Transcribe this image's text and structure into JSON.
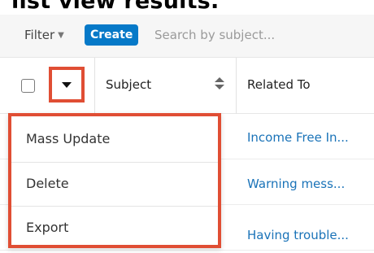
{
  "heading": {
    "text": "list view results."
  },
  "toolbar": {
    "filter_label": "Filter",
    "create_label": "Create",
    "search_placeholder": "Search by subject..."
  },
  "table": {
    "columns": [
      {
        "label": "Subject",
        "sortable": true
      },
      {
        "label": "Related To",
        "sortable": false
      }
    ],
    "rows": [
      {
        "related_to": "Income Free In..."
      },
      {
        "related_to": "Warning mess..."
      },
      {
        "related_to": "Having trouble..."
      }
    ]
  },
  "actions_menu": {
    "items": [
      {
        "label": "Mass Update"
      },
      {
        "label": "Delete"
      },
      {
        "label": "Export"
      }
    ]
  },
  "colors": {
    "accent": "#0679c8",
    "highlight": "#e04e34",
    "link": "#1a73b8"
  },
  "icons": {
    "filter_caret": "chevron-down-icon",
    "actions_toggle": "caret-down-icon",
    "sort": "sort-icon"
  }
}
